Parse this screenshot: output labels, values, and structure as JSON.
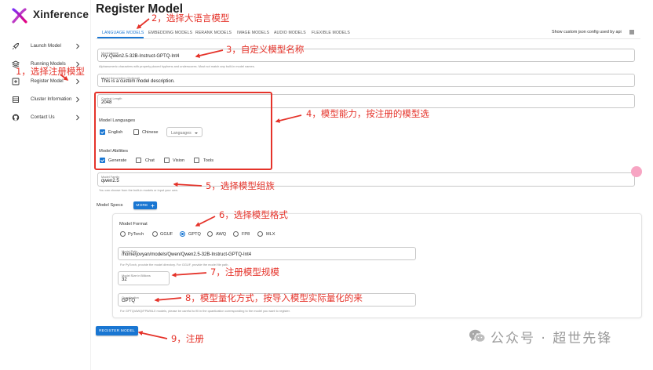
{
  "app": {
    "name": "Xinference"
  },
  "sidebar": {
    "items": [
      {
        "label": "Launch Model",
        "icon": "rocket-icon"
      },
      {
        "label": "Running Models",
        "icon": "layers-icon"
      },
      {
        "label": "Register Model",
        "icon": "plus-square-icon"
      },
      {
        "label": "Cluster Information",
        "icon": "server-icon"
      },
      {
        "label": "Contact Us",
        "icon": "github-icon"
      }
    ]
  },
  "page": {
    "title": "Register Model"
  },
  "tabs": [
    {
      "label": "LANGUAGE MODELS",
      "active": true
    },
    {
      "label": "EMBEDDING MODELS",
      "active": false
    },
    {
      "label": "RERANK MODELS",
      "active": false
    },
    {
      "label": "IMAGE MODELS",
      "active": false
    },
    {
      "label": "AUDIO MODELS",
      "active": false
    },
    {
      "label": "FLEXIBLE MODELS",
      "active": false
    }
  ],
  "json_toggle": {
    "label": "Show custom json config used by api"
  },
  "form": {
    "model_name": {
      "label": "Model Name",
      "value": "my-Qwen2.5-32B-Instruct-GPTQ-Int4",
      "helper": "Alphanumeric characters with properly placed hyphens and underscores. Must not match any built-in model names."
    },
    "model_description": {
      "label": "Model Description (Optional)",
      "value": "This is a custom model description."
    },
    "context_length": {
      "label": "Context Length",
      "value": "2048"
    },
    "model_languages": {
      "title": "Model Languages",
      "options": [
        {
          "label": "English",
          "checked": true
        },
        {
          "label": "Chinese",
          "checked": false
        }
      ],
      "select_placeholder": "Languages"
    },
    "model_abilities": {
      "title": "Model Abilities",
      "options": [
        {
          "label": "Generate",
          "checked": true
        },
        {
          "label": "Chat",
          "checked": false
        },
        {
          "label": "Vision",
          "checked": false
        },
        {
          "label": "Tools",
          "checked": false
        }
      ]
    },
    "model_family": {
      "label": "Model Family",
      "value": "qwen2.5",
      "helper": "You can choose from the built-in models or input your own."
    },
    "model_specs": {
      "title": "Model Specs",
      "more_button": "MORE"
    },
    "spec": {
      "model_format": {
        "title": "Model Format",
        "options": [
          {
            "label": "PyTorch",
            "selected": false
          },
          {
            "label": "GGUF",
            "selected": false
          },
          {
            "label": "GPTQ",
            "selected": true
          },
          {
            "label": "AWQ",
            "selected": false
          },
          {
            "label": "FP8",
            "selected": false
          },
          {
            "label": "MLX",
            "selected": false
          }
        ]
      },
      "model_path": {
        "label": "Model Path",
        "value": "/home/jovyan/models/Qwen/Qwen2.5-32B-Instruct-GPTQ-Int4",
        "helper": "For PyTorch, provide the model directory. For GGUF, provide the model file path."
      },
      "model_size": {
        "label": "Model Size in Billions",
        "value": "32"
      },
      "quantization": {
        "label": "Quantization",
        "value": "GPTQ",
        "helper": "For GPTQ/AWQ/FP8/MLX models, please be careful to fill in the quantization corresponding to the model you want to register."
      }
    },
    "register_button": "REGISTER MODEL"
  },
  "annotations": [
    "1，选择注册模型",
    "2，选择大语言模型",
    "3，自定义模型名称",
    "4，模型能力，按注册的模型选",
    "5，选择模型组族",
    "6，选择模型格式",
    "7，注册模型规模",
    "8，模型量化方式，按导入模型实际量化的来",
    "9，注册"
  ],
  "watermark": {
    "text": "公众号 · 超世先锋",
    "icon": "wechat-icon"
  },
  "colors": {
    "accent": "#1976d2",
    "annotation": "#e5332a",
    "logo_start": "#7b2ff7",
    "logo_end": "#e5007e",
    "watermark": "#9a9a9a"
  }
}
